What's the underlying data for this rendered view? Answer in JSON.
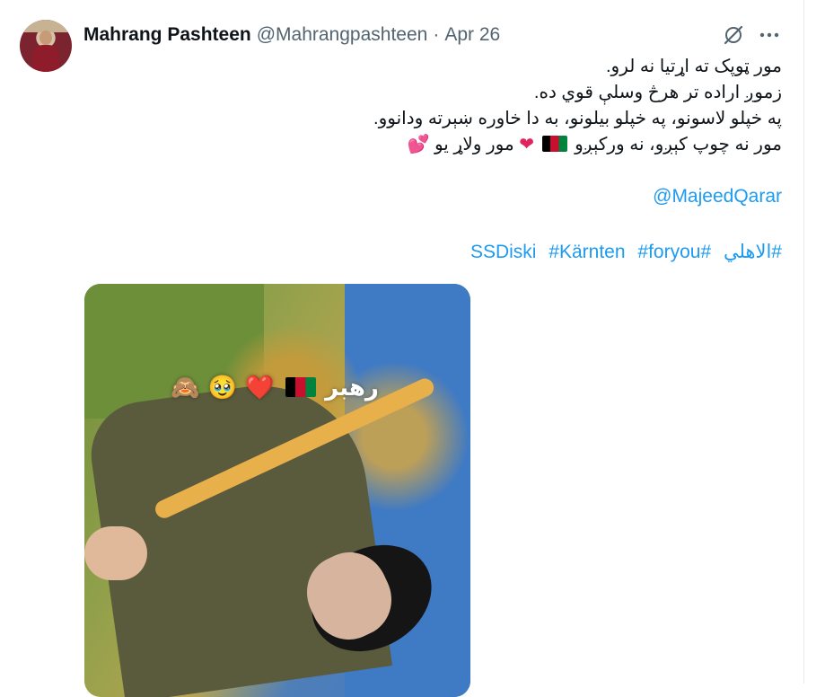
{
  "tweet": {
    "author_name": "Mahrang Pashteen",
    "handle": "@Mahrangpashteen",
    "separator": "·",
    "date": "Apr 26",
    "lines": [
      "مور ټوپک ته اړتيا نه لرو.",
      "زموږ اراده تر هرڅ وسلې قوي ده.",
      "په خپلو لاسونو، په خپلو بیلونو، به دا خاوره ښېرته ودانوو."
    ],
    "line4_text_a": "مور نه چوپ کېږو، نه ورکېږو",
    "line4_text_b": "مور ولاړ یو",
    "mention": "@MajeedQarar",
    "hashtags": [
      "#الاهلي",
      "#SSDiski",
      "#Kärnten",
      "#foryou"
    ]
  },
  "media": {
    "overlay_text": "رهبر",
    "overlay_emojis": [
      "❤️",
      "🥹",
      "🙈"
    ]
  },
  "icons": {
    "grok": "grok-icon",
    "more": "more-icon"
  },
  "colors": {
    "link": "#1d9bf0",
    "secondary_text": "#536471",
    "heart": "#e0245e"
  }
}
